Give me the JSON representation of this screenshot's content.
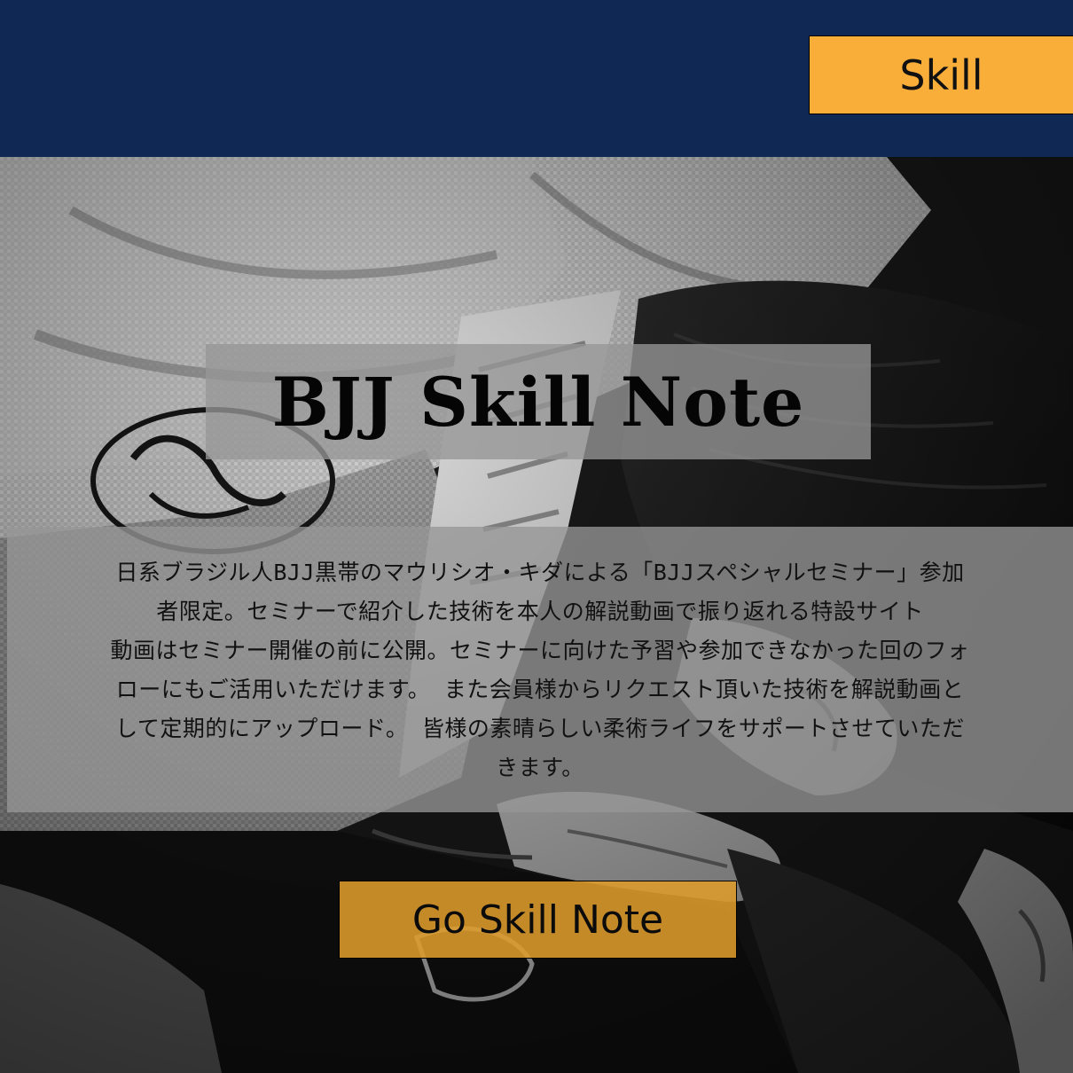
{
  "header": {
    "nav_button_label": "Skill",
    "background_color": "#0f2954",
    "button_color": "#f9ae3a"
  },
  "hero": {
    "title": "BJJ Skill Note",
    "description_lines": [
      "日系ブラジル人BJJ黒帯のマウリシオ・キダによる「BJJスペシャルセミナー」参加",
      "者限定。セミナーで紹介した技術を本人の解説動画で振り返れる特設サイト",
      "動画はセミナー開催の前に公開。セミナーに向けた予習や参加できなかった回のフォ",
      "ローにもご活用いただけます。 また会員様からリクエスト頂いた技術を解説動画と",
      "して定期的にアップロード。 皆様の素晴らしい柔術ライフをサポートさせていただ",
      "きます。"
    ],
    "cta_label": "Go Skill Note",
    "cta_color": "#de9c2c"
  }
}
